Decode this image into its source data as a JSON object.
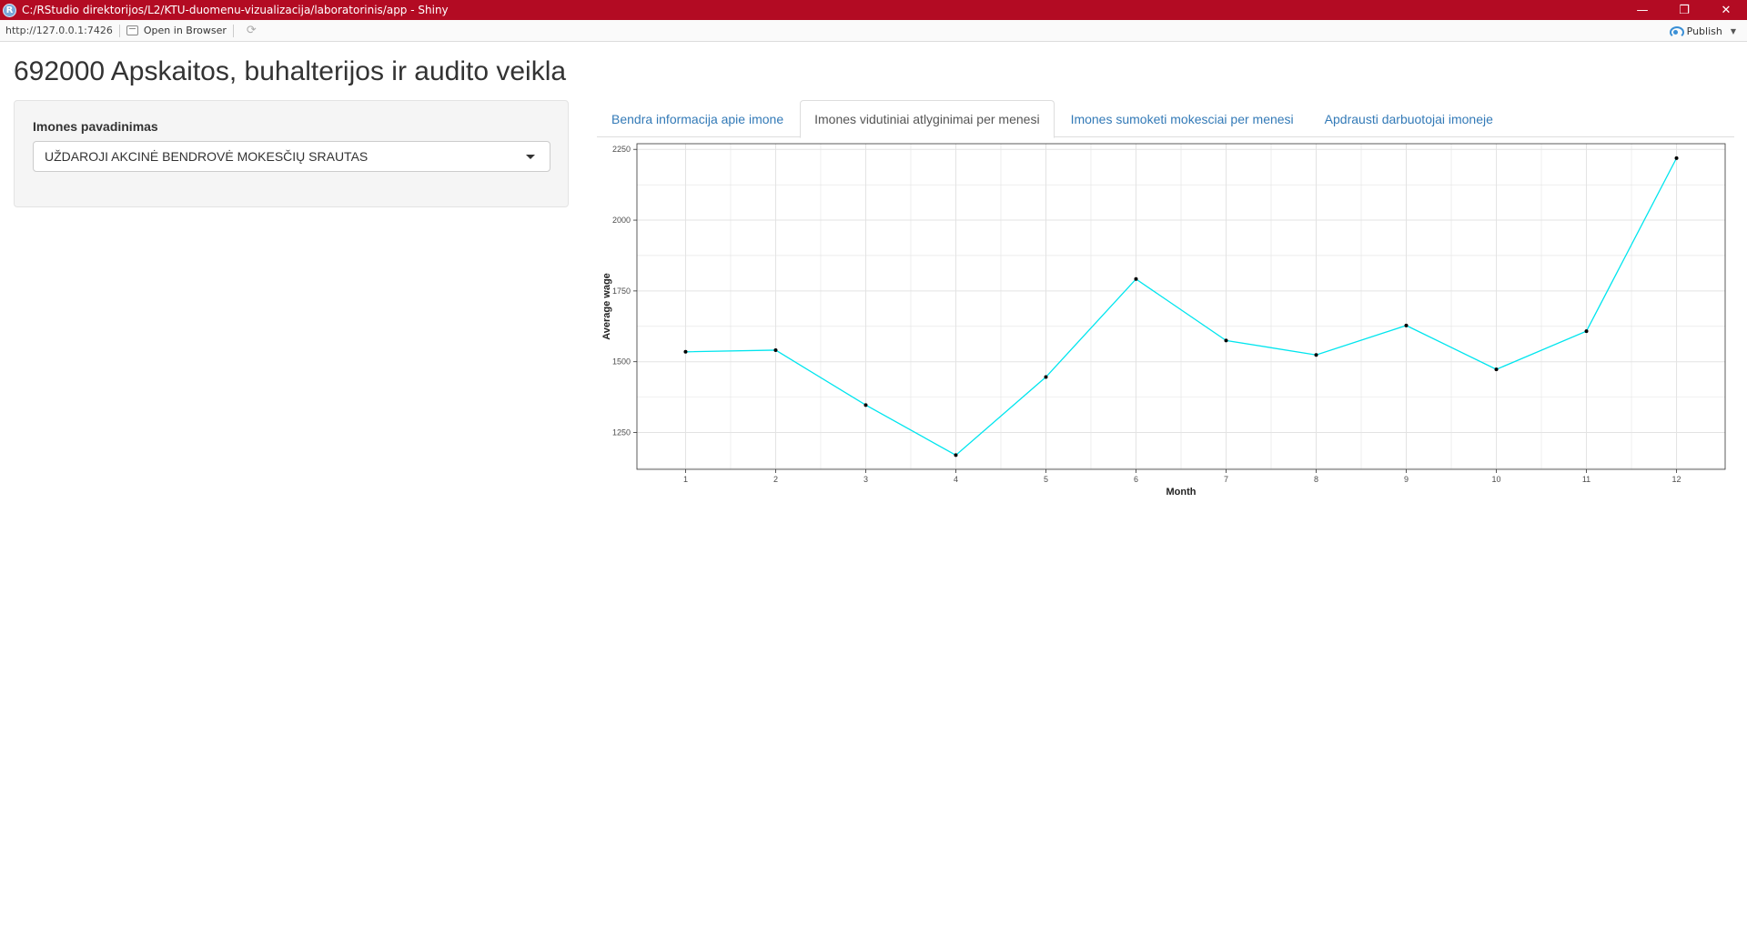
{
  "window": {
    "title": "C:/RStudio direktorijos/L2/KTU-duomenu-vizualizacija/laboratorinis/app - Shiny",
    "app_icon": "R",
    "controls": {
      "minimize": "—",
      "restore": "❐",
      "close": "✕"
    }
  },
  "toolbar": {
    "url": "http://127.0.0.1:7426",
    "open_in_browser": "Open in Browser",
    "publish": "Publish"
  },
  "page": {
    "title": "692000 Apskaitos, buhalterijos ir audito veikla"
  },
  "sidebar": {
    "label": "Imones pavadinimas",
    "selected": "UŽDAROJI AKCINĖ BENDROVĖ MOKESČIŲ SRAUTAS"
  },
  "tabs": [
    {
      "label": "Bendra informacija apie imone",
      "active": false
    },
    {
      "label": "Imones vidutiniai atlyginimai per menesi",
      "active": true
    },
    {
      "label": "Imones sumoketi mokesciai per menesi",
      "active": false
    },
    {
      "label": "Apdrausti darbuotojai imoneje",
      "active": false
    }
  ],
  "chart_data": {
    "type": "line",
    "title": "",
    "xlabel": "Month",
    "ylabel": "Average wage",
    "x": [
      1,
      2,
      3,
      4,
      5,
      6,
      7,
      8,
      9,
      10,
      11,
      12
    ],
    "y": [
      1535,
      1541,
      1347,
      1170,
      1446,
      1792,
      1575,
      1524,
      1628,
      1473,
      1608,
      2219
    ],
    "xlim": [
      0.46,
      12.54
    ],
    "ylim": [
      1120,
      2270
    ],
    "yticks": [
      1250,
      1500,
      1750,
      2000,
      2250
    ],
    "xticks": [
      1,
      2,
      3,
      4,
      5,
      6,
      7,
      8,
      9,
      10,
      11,
      12
    ],
    "line_color": "#00e5ee",
    "point_color": "#000000",
    "grid": true
  }
}
